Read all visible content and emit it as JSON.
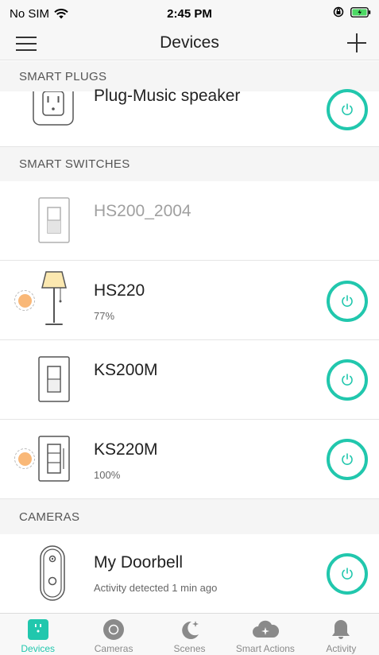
{
  "status_bar": {
    "carrier": "No SIM",
    "time": "2:45 PM"
  },
  "nav": {
    "title": "Devices"
  },
  "sections": {
    "plugs": "SMART PLUGS",
    "switches": "SMART SWITCHES",
    "cameras": "CAMERAS"
  },
  "devices": {
    "plug_music": {
      "name": "Plug-Music speaker"
    },
    "hs200": {
      "name": "HS200_2004"
    },
    "hs220": {
      "name": "HS220",
      "brightness": "77%"
    },
    "ks200m": {
      "name": "KS200M"
    },
    "ks220m": {
      "name": "KS220M",
      "brightness": "100%"
    },
    "doorbell": {
      "name": "My Doorbell",
      "status": "Activity detected 1 min ago"
    }
  },
  "tabs": [
    {
      "label": "Devices",
      "icon": "devices-icon"
    },
    {
      "label": "Cameras",
      "icon": "camera-icon"
    },
    {
      "label": "Scenes",
      "icon": "scenes-icon"
    },
    {
      "label": "Smart Actions",
      "icon": "smart-actions-icon"
    },
    {
      "label": "Activity",
      "icon": "bell-icon"
    }
  ],
  "colors": {
    "accent": "#21c7ad",
    "glow": "#f9b878"
  }
}
